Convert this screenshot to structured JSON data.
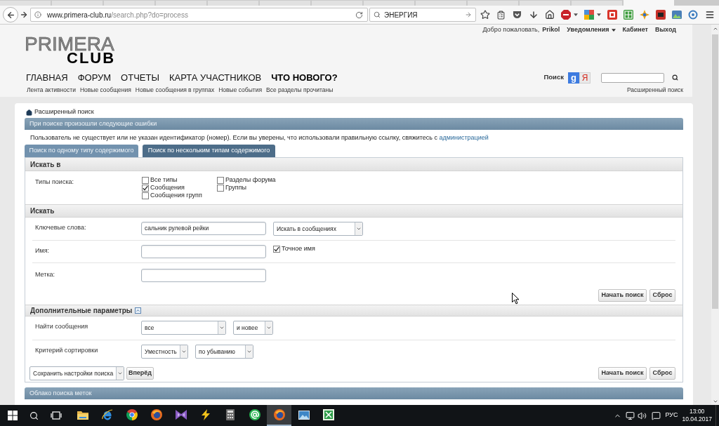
{
  "browser": {
    "tabs": [
      {
        "selected": false
      },
      {
        "selected": false
      },
      {
        "selected": false
      },
      {
        "selected": false
      },
      {
        "selected": false
      },
      {
        "selected": false
      },
      {
        "selected": false
      },
      {
        "selected": false
      },
      {
        "selected": false
      },
      {
        "selected": false
      },
      {
        "selected": false
      },
      {
        "selected": false
      },
      {
        "selected": true
      }
    ],
    "url_host": "www.primera-club.ru",
    "url_path": "/search.php?do=process",
    "search_value": "ЭНЕРГИЯ"
  },
  "header": {
    "logo": {
      "top": "PRIMERA",
      "bottom": "CLUB"
    },
    "welcome": "Добро пожаловать,",
    "username": "Prikol",
    "user_links": [
      {
        "label": "Уведомления",
        "dropdown": true
      },
      {
        "label": "Кабинет",
        "dropdown": false
      },
      {
        "label": "Выход",
        "dropdown": false
      }
    ],
    "nav": [
      {
        "label": "ГЛАВНАЯ",
        "selected": false
      },
      {
        "label": "ФОРУМ",
        "selected": false
      },
      {
        "label": "ОТЧЕТЫ",
        "selected": false
      },
      {
        "label": "КАРТА УЧАСТНИКОВ",
        "selected": false
      },
      {
        "label": "ЧТО НОВОГО?",
        "selected": true
      }
    ],
    "subnav": [
      "Лента активности",
      "Новые сообщения",
      "Новые сообщения в группах",
      "Новые события",
      "Все разделы прочитаны"
    ],
    "search_label": "Поиск",
    "search_engines": [
      {
        "label": "g",
        "kind": "filled"
      },
      {
        "label": "Я",
        "kind": "light"
      }
    ],
    "advanced_search": "Расширенный поиск"
  },
  "breadcrumb": "Расширенный поиск",
  "error": {
    "title": "При поиске произошли следующие ошибки",
    "message": "Пользователь не существует или не указан идентификатор (номер). Если вы уверены, что использовали правильную ссылку, свяжитесь с ",
    "link": "администрацией"
  },
  "tabs": [
    {
      "label": "Поиск по одному типу содержимого",
      "selected": false
    },
    {
      "label": "Поиск по нескольким типам содержимого",
      "selected": true
    }
  ],
  "search_in": {
    "title": "Искать в",
    "label": "Типы поиска:",
    "columns": [
      [
        {
          "label": "Все типы",
          "checked": false
        },
        {
          "label": "Сообщения",
          "checked": true
        },
        {
          "label": "Сообщения групп",
          "checked": false
        }
      ],
      [
        {
          "label": "Разделы форума",
          "checked": false
        },
        {
          "label": "Группы",
          "checked": false
        }
      ]
    ]
  },
  "search": {
    "title": "Искать",
    "rows": [
      {
        "label": "Ключевые слова:",
        "value": "сальник рулевой рейки",
        "select": "Искать в сообщениях"
      },
      {
        "label": "Имя:",
        "checkbox": {
          "label": "Точное имя",
          "checked": true
        }
      },
      {
        "label": "Метка:"
      }
    ],
    "buttons": [
      "Начать поиск",
      "Сброс"
    ]
  },
  "advanced": {
    "title": "Дополнительные параметры",
    "expanded": true,
    "rows": [
      {
        "label": "Найти сообщения",
        "selects": [
          "все",
          "и новее"
        ]
      },
      {
        "label": "Критерий сортировки",
        "selects": [
          "Уместность",
          "по убыванию"
        ]
      }
    ],
    "save_select": "Сохранить настройки поиска",
    "forward_button": "Вперёд",
    "buttons": [
      "Начать поиск",
      "Сброс"
    ]
  },
  "tag_cloud": {
    "title": "Облако поиска меток"
  },
  "taskbar": {
    "apps": [
      {
        "kind": "folder",
        "selected": false
      },
      {
        "kind": "e",
        "selected": false
      },
      {
        "kind": "wheel",
        "selected": false
      },
      {
        "kind": "globe",
        "selected": false
      },
      {
        "kind": "bowtie",
        "selected": false
      },
      {
        "kind": "bolt",
        "selected": false
      },
      {
        "kind": "calculator",
        "selected": false
      },
      {
        "kind": "at",
        "selected": false
      },
      {
        "kind": "globe",
        "selected": true
      },
      {
        "kind": "picture",
        "selected": false
      },
      {
        "kind": "sheet",
        "selected": false
      }
    ],
    "language": "РУС",
    "time": "13:00",
    "date": "10.04.2017"
  }
}
